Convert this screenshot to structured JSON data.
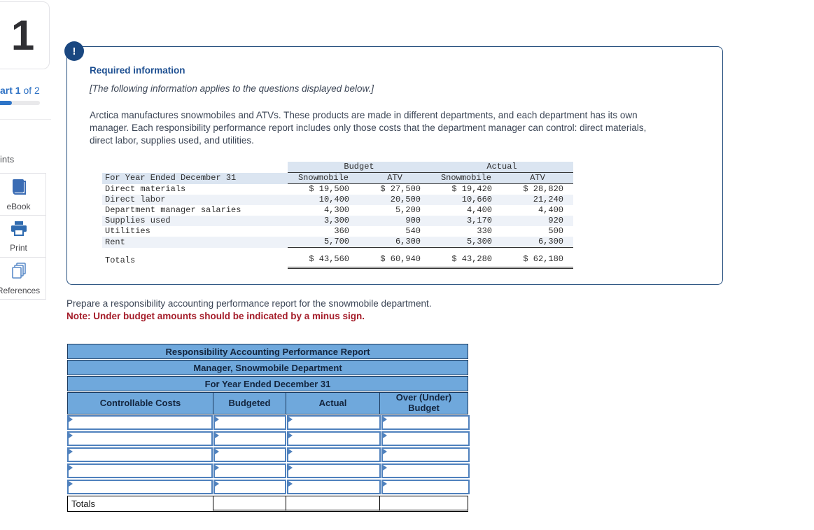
{
  "sidebar": {
    "question_number": "1",
    "part_bold": "art 1",
    "part_rest": " of 2",
    "progress_percent": 48,
    "hints_label": "ints",
    "tools": [
      {
        "label": "eBook",
        "icon": "book-icon"
      },
      {
        "label": "Print",
        "icon": "printer-icon"
      },
      {
        "label": "References",
        "icon": "references-icon"
      }
    ]
  },
  "required_info": {
    "alert_glyph": "!",
    "title": "Required information",
    "subtitle": "[The following information applies to the questions displayed below.]",
    "paragraph": "Arctica manufactures snowmobiles and ATVs. These products are made in different departments, and each department has its own manager. Each responsibility performance report includes only those costs that the department manager can control: direct materials, direct labor, supplies used, and utilities."
  },
  "cost_table": {
    "col_groups": [
      "Budget",
      "Actual"
    ],
    "header_label": "For Year Ended December 31",
    "sub_columns": [
      "Snowmobile",
      "ATV",
      "Snowmobile",
      "ATV"
    ],
    "rows": [
      {
        "label": "Direct materials",
        "values": [
          "$ 19,500",
          "$ 27,500",
          "$ 19,420",
          "$ 28,820"
        ]
      },
      {
        "label": "Direct labor",
        "values": [
          "10,400",
          "20,500",
          "10,660",
          "21,240"
        ]
      },
      {
        "label": "Department manager salaries",
        "values": [
          "4,300",
          "5,200",
          "4,400",
          "4,400"
        ]
      },
      {
        "label": "Supplies used",
        "values": [
          "3,300",
          "900",
          "3,170",
          "920"
        ]
      },
      {
        "label": "Utilities",
        "values": [
          "360",
          "540",
          "330",
          "500"
        ]
      },
      {
        "label": "Rent",
        "values": [
          "5,700",
          "6,300",
          "5,300",
          "6,300"
        ]
      }
    ],
    "totals": {
      "label": "Totals",
      "values": [
        "$ 43,560",
        "$ 60,940",
        "$ 43,280",
        "$ 62,180"
      ]
    }
  },
  "question": {
    "instruction": "Prepare a responsibility accounting performance report for the snowmobile department.",
    "note": "Note: Under budget amounts should be indicated by a minus sign."
  },
  "answer_table": {
    "title_rows": [
      "Responsibility Accounting Performance Report",
      "Manager, Snowmobile Department",
      "For Year Ended December 31"
    ],
    "column_headers": [
      "Controllable Costs",
      "Budgeted",
      "Actual",
      "Over (Under) Budget"
    ],
    "input_row_count": 5,
    "totals_label": "Totals"
  },
  "colors": {
    "accent_blue": "#2e75c8",
    "panel_border_navy": "#27507f",
    "table_header_blue": "#6fa8dc",
    "input_border_blue": "#4f81bd",
    "note_red": "#a41c29",
    "cost_header_band": "#dbe5f1",
    "cost_stripe": "#eef2f8"
  }
}
